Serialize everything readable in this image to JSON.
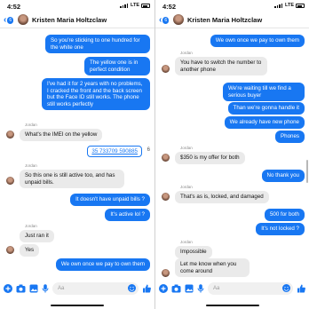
{
  "left": {
    "status": {
      "time": "4:52",
      "network": "LTE"
    },
    "header": {
      "back_count": "6",
      "contact": "Kristen Maria Holtzclaw"
    },
    "messages": {
      "m1": "So you're sticking to one hundred for the white one",
      "m2": "The yellow one is in perfect condition",
      "m3": "I've had it for 2 years with no problems, I cracked the front and the back screen but the Face ID still works. The phone still works perfectly",
      "s1": "Jordan",
      "m4": "What's the IMEI on the yellow",
      "imei": "35 733709 590885",
      "imei_suffix": "6",
      "s2": "Jordan",
      "m5": "So this one is still active too, and has unpaid bills.",
      "m6": "It doesn't have unpaid bills ?",
      "m7": "It's active lol ?",
      "s3": "Jordan",
      "m8": "Just ran it",
      "m9": "Yes",
      "m10": "We own once we pay to own them"
    },
    "composer": {
      "placeholder": "Aa"
    }
  },
  "right": {
    "status": {
      "time": "4:52",
      "network": "LTE"
    },
    "header": {
      "back_count": "6",
      "contact": "Kristen Maria Holtzclaw"
    },
    "messages": {
      "m1": "We own once we pay to own them",
      "s1": "Jordan",
      "m2": "You have to switch the number to another phone",
      "m3": "We're waiting till we find a serious buyer",
      "m4": "Than we're gonna handle it",
      "m5": "We already have new phone",
      "m6": "Phones",
      "s2": "Jordan",
      "m7": "$350 is my offer for both",
      "m8": "No thank you",
      "s3": "Jordan",
      "m9": "That's as is, locked, and damaged",
      "m10": "500 for both",
      "m11": "It's not locked ?",
      "s4": "Jordan",
      "m12": "Impossible",
      "m13": "Let me know when you come around"
    },
    "composer": {
      "placeholder": "Aa"
    }
  },
  "colors": {
    "accent": "#1877f2",
    "incoming": "#eaeaea"
  }
}
